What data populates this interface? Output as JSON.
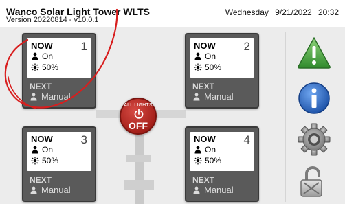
{
  "header": {
    "title": "Wanco Solar Light Tower WLTS",
    "version": "Version 20220814 - v10.0.1",
    "day": "Wednesday",
    "date": "9/21/2022",
    "time": "20:32"
  },
  "panels": [
    {
      "number": "1",
      "now_label": "NOW",
      "now_status": "On",
      "brightness": "50%",
      "next_label": "NEXT",
      "next_mode": "Manual"
    },
    {
      "number": "2",
      "now_label": "NOW",
      "now_status": "On",
      "brightness": "50%",
      "next_label": "NEXT",
      "next_mode": "Manual"
    },
    {
      "number": "3",
      "now_label": "NOW",
      "now_status": "On",
      "brightness": "50%",
      "next_label": "NEXT",
      "next_mode": "Manual"
    },
    {
      "number": "4",
      "now_label": "NOW",
      "now_status": "On",
      "brightness": "50%",
      "next_label": "NEXT",
      "next_mode": "Manual"
    }
  ],
  "all_lights": {
    "label": "ALL LIGHTS",
    "state": "OFF"
  },
  "side_icons": [
    "warning-icon",
    "info-icon",
    "settings-gear-icon",
    "unlocked-padlock-icon"
  ],
  "colors": {
    "panel": "#5a5a5a",
    "all_lights_button": "#a5201a",
    "warning": "#3a9c3a",
    "info": "#1f5fb8",
    "annotation": "#d81e1e"
  }
}
